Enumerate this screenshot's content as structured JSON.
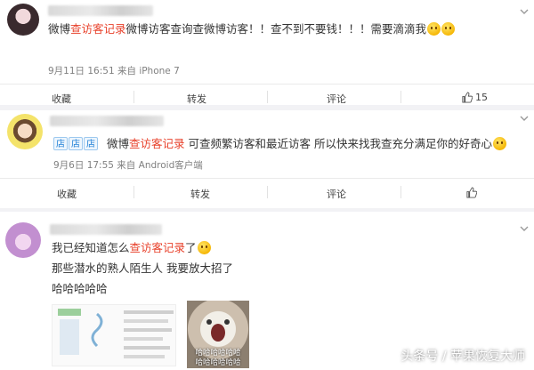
{
  "posts": [
    {
      "text_prefix": "微博",
      "text_highlight": "查访客记录",
      "text_suffix": "微博访客查询查微博访客！！查不到不要钱！！！需要滴滴我",
      "meta": "9月11日 16:51 来自 iPhone 7",
      "actions": {
        "collect": "收藏",
        "forward": "转发",
        "comment": "评论",
        "like_count": "15"
      }
    },
    {
      "badges": [
        "店",
        "店",
        "店"
      ],
      "text_prefix": "微博",
      "text_highlight": "查访客记录",
      "text_suffix": " 可查频繁访客和最近访客 所以快来找我查充分满足你的好奇心",
      "meta": "9月6日 17:55 来自 Android客户端",
      "actions": {
        "collect": "收藏",
        "forward": "转发",
        "comment": "评论"
      }
    },
    {
      "line1_prefix": "我已经知道怎么",
      "line1_highlight": "查访客记录",
      "line1_suffix": "了",
      "line2": "那些潜水的熟人陌生人 我要放大招了",
      "line3": "哈哈哈哈哈",
      "meme_text_top": "哈哈哈哈哈哈",
      "meme_text_bottom": "哈哈哈哈哈哈"
    }
  ],
  "watermark": "头条号 / 苹果恢复大师",
  "colors": {
    "highlight": "#e8412b",
    "meta": "#808080",
    "background": "#f2f2f5"
  }
}
